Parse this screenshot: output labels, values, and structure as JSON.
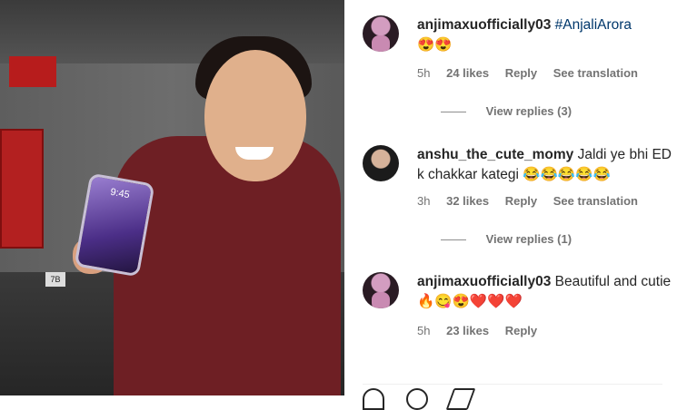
{
  "comments": [
    {
      "username": "anjimaxuofficially03",
      "hashtag": "#AnjaliArora",
      "text": "",
      "emoji": "😍😍",
      "time": "5h",
      "likes": "24 likes",
      "reply": "Reply",
      "translation": "See translation",
      "view_replies": "View replies (3)"
    },
    {
      "username": "anshu_the_cute_momy",
      "text": "Jaldi ye bhi ED k chakkar kategi",
      "emoji": "😂😂😂😂😂",
      "time": "3h",
      "likes": "32 likes",
      "reply": "Reply",
      "translation": "See translation",
      "view_replies": "View replies (1)"
    },
    {
      "username": "anjimaxuofficially03",
      "text": "Beautiful and cutie",
      "emoji": "🔥😋😍❤️❤️❤️",
      "time": "5h",
      "likes": "23 likes",
      "reply": "Reply"
    }
  ],
  "media": {
    "phone_time": "9:45",
    "pillar_number": "7B"
  }
}
